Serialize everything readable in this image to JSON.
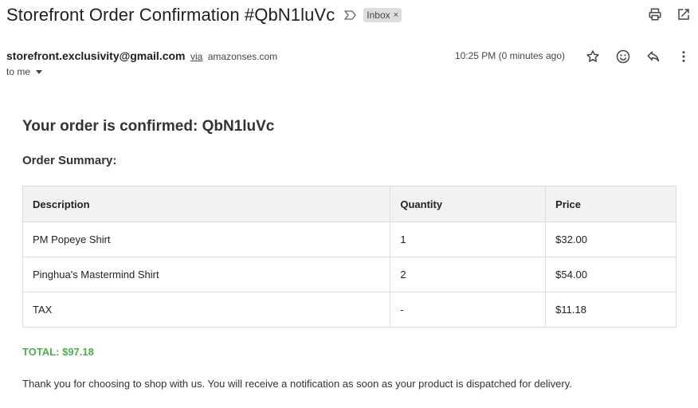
{
  "header": {
    "subject": "Storefront Order Confirmation #QbN1luVc",
    "label": "Inbox",
    "label_remove": "×"
  },
  "message": {
    "sender": "storefront.exclusivity@gmail.com",
    "via_label": "via",
    "via_domain": "amazonses.com",
    "recipient": "to me",
    "time": "10:25 PM (0 minutes ago)"
  },
  "email": {
    "heading": "Your order is confirmed: QbN1luVc",
    "summary_title": "Order Summary:",
    "table": {
      "headers": [
        "Description",
        "Quantity",
        "Price"
      ],
      "rows": [
        [
          "PM Popeye Shirt",
          "1",
          "$32.00"
        ],
        [
          "Pinghua's Mastermind Shirt",
          "2",
          "$54.00"
        ],
        [
          "TAX",
          "-",
          "$11.18"
        ]
      ]
    },
    "total": "TOTAL: $97.18",
    "thanks": "Thank you for choosing to shop with us. You will receive a notification as soon as your product is dispatched for delivery."
  },
  "colors": {
    "total": "#4caf50",
    "table_header_bg": "#f2f2f2",
    "table_border": "#dddddd"
  },
  "icons": [
    "importance-marker-icon",
    "print-icon",
    "open-in-new-window-icon",
    "star-icon",
    "emoji-icon",
    "reply-icon",
    "more-vert-icon",
    "chevron-down-icon"
  ]
}
